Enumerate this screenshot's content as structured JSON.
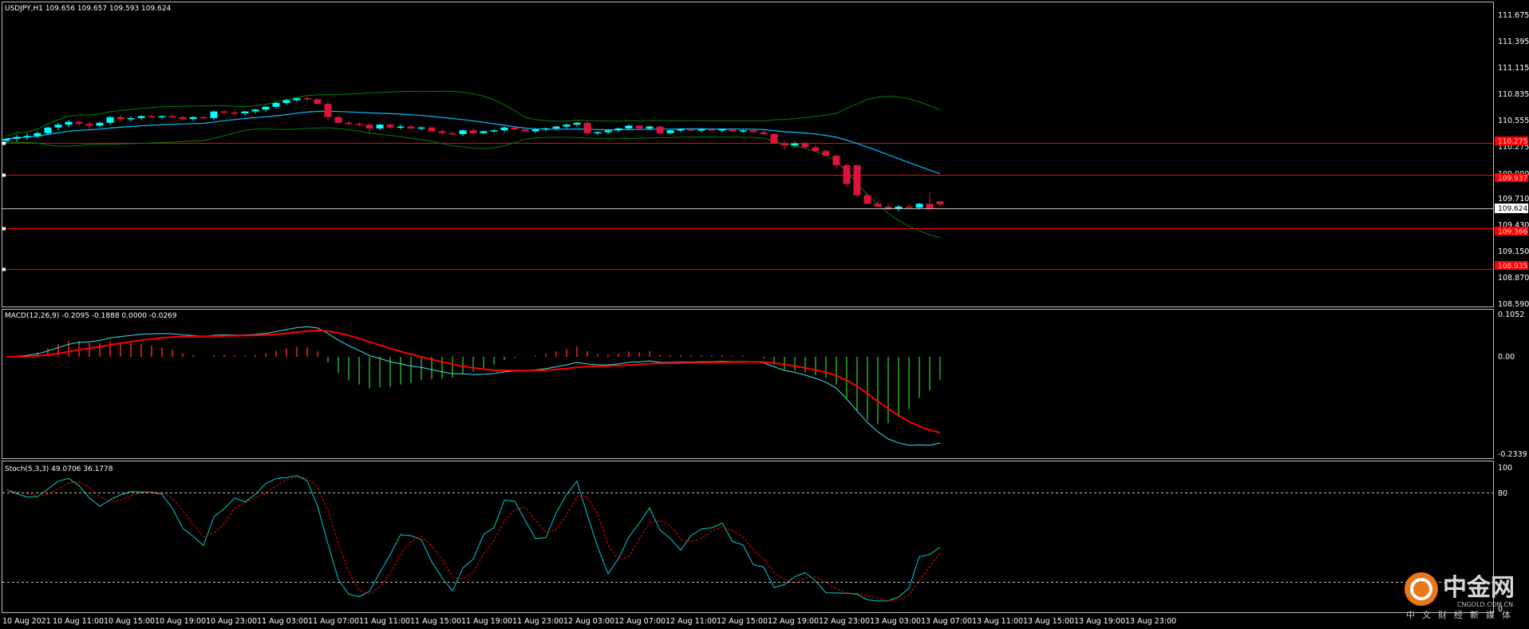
{
  "header": {
    "title": "USDJPY,H1  109.656 109.657 109.593 109.624",
    "macd_label": "MACD(12,26,9) -0.2095 -0.1888 0.0000 -0.0269",
    "stoch_label": "Stoch(5,3,3) 49.0706 36.1778"
  },
  "colors": {
    "background": "#000000",
    "bull_candle": "#00ffff",
    "bear_candle": "#dc143c",
    "band_outer": "#008000",
    "band_mid": "#00bfff",
    "level_line": "#ff0000",
    "macd_signal": "#ff0000",
    "stoch_main": "#00ced1",
    "stoch_signal": "#ff0000"
  },
  "price_axis": {
    "labels": [
      "111.675",
      "111.395",
      "111.115",
      "110.835",
      "110.555",
      "110.275",
      "109.990",
      "109.710",
      "109.430",
      "109.150",
      "108.870",
      "108.590"
    ],
    "current_price": "109.624",
    "level_tags": [
      "110.275",
      "109.937",
      "109.366",
      "108.935"
    ]
  },
  "macd_axis": {
    "labels": [
      "0.1052",
      "0.00",
      "-0.2339"
    ]
  },
  "stoch_axis": {
    "labels": [
      "100",
      "80",
      "0"
    ]
  },
  "time_axis": {
    "labels": [
      "10 Aug 2021",
      "10 Aug 11:00",
      "10 Aug 15:00",
      "10 Aug 19:00",
      "10 Aug 23:00",
      "11 Aug 03:00",
      "11 Aug 07:00",
      "11 Aug 11:00",
      "11 Aug 15:00",
      "11 Aug 19:00",
      "11 Aug 23:00",
      "12 Aug 03:00",
      "12 Aug 07:00",
      "12 Aug 11:00",
      "12 Aug 15:00",
      "12 Aug 19:00",
      "12 Aug 23:00",
      "13 Aug 03:00",
      "13 Aug 07:00",
      "13 Aug 11:00",
      "13 Aug 15:00",
      "13 Aug 19:00",
      "13 Aug 23:00"
    ]
  },
  "watermark": {
    "brand": "中金网",
    "domain": "CNGOLD.COM.CN",
    "sub": "中文财经新媒体"
  },
  "chart_data": {
    "type": "candlestick",
    "symbol": "USDJPY",
    "timeframe": "H1",
    "ylim": [
      108.59,
      111.675
    ],
    "horizontal_levels": [
      110.275,
      109.937,
      109.366,
      108.935
    ],
    "candles_ohlc": [
      [
        110.3,
        110.33,
        110.27,
        110.32
      ],
      [
        110.32,
        110.36,
        110.29,
        110.34
      ],
      [
        110.34,
        110.38,
        110.31,
        110.35
      ],
      [
        110.35,
        110.4,
        110.33,
        110.38
      ],
      [
        110.38,
        110.45,
        110.36,
        110.44
      ],
      [
        110.44,
        110.49,
        110.41,
        110.47
      ],
      [
        110.47,
        110.52,
        110.44,
        110.5
      ],
      [
        110.5,
        110.52,
        110.46,
        110.48
      ],
      [
        110.48,
        110.5,
        110.42,
        110.46
      ],
      [
        110.46,
        110.5,
        110.44,
        110.49
      ],
      [
        110.49,
        110.56,
        110.47,
        110.55
      ],
      [
        110.55,
        110.57,
        110.51,
        110.53
      ],
      [
        110.53,
        110.56,
        110.5,
        110.54
      ],
      [
        110.54,
        110.57,
        110.52,
        110.56
      ],
      [
        110.56,
        110.58,
        110.54,
        110.55
      ],
      [
        110.55,
        110.57,
        110.53,
        110.56
      ],
      [
        110.56,
        110.58,
        110.54,
        110.55
      ],
      [
        110.55,
        110.56,
        110.51,
        110.53
      ],
      [
        110.53,
        110.56,
        110.51,
        110.55
      ],
      [
        110.55,
        110.56,
        110.52,
        110.54
      ],
      [
        110.54,
        110.62,
        110.52,
        110.61
      ],
      [
        110.61,
        110.63,
        110.58,
        110.6
      ],
      [
        110.6,
        110.62,
        110.57,
        110.59
      ],
      [
        110.59,
        110.62,
        110.57,
        110.61
      ],
      [
        110.61,
        110.64,
        110.59,
        110.63
      ],
      [
        110.63,
        110.67,
        110.61,
        110.66
      ],
      [
        110.66,
        110.71,
        110.64,
        110.7
      ],
      [
        110.7,
        110.74,
        110.68,
        110.73
      ],
      [
        110.73,
        110.76,
        110.71,
        110.75
      ],
      [
        110.75,
        110.77,
        110.72,
        110.74
      ],
      [
        110.74,
        110.75,
        110.68,
        110.69
      ],
      [
        110.69,
        110.71,
        110.52,
        110.55
      ],
      [
        110.55,
        110.57,
        110.48,
        110.49
      ],
      [
        110.49,
        110.51,
        110.46,
        110.48
      ],
      [
        110.48,
        110.5,
        110.45,
        110.47
      ],
      [
        110.47,
        110.49,
        110.38,
        110.43
      ],
      [
        110.43,
        110.48,
        110.41,
        110.47
      ],
      [
        110.47,
        110.49,
        110.42,
        110.44
      ],
      [
        110.44,
        110.47,
        110.42,
        110.45
      ],
      [
        110.45,
        110.47,
        110.42,
        110.43
      ],
      [
        110.43,
        110.45,
        110.41,
        110.44
      ],
      [
        110.44,
        110.45,
        110.39,
        110.4
      ],
      [
        110.4,
        110.42,
        110.37,
        110.38
      ],
      [
        110.38,
        110.4,
        110.36,
        110.37
      ],
      [
        110.37,
        110.42,
        110.35,
        110.41
      ],
      [
        110.41,
        110.43,
        110.36,
        110.38
      ],
      [
        110.38,
        110.41,
        110.37,
        110.4
      ],
      [
        110.4,
        110.42,
        110.38,
        110.41
      ],
      [
        110.41,
        110.45,
        110.39,
        110.44
      ],
      [
        110.44,
        110.46,
        110.41,
        110.42
      ],
      [
        110.42,
        110.44,
        110.39,
        110.4
      ],
      [
        110.4,
        110.43,
        110.38,
        110.42
      ],
      [
        110.42,
        110.44,
        110.4,
        110.43
      ],
      [
        110.43,
        110.46,
        110.41,
        110.45
      ],
      [
        110.45,
        110.48,
        110.43,
        110.47
      ],
      [
        110.47,
        110.5,
        110.45,
        110.49
      ],
      [
        110.49,
        110.51,
        110.36,
        110.38
      ],
      [
        110.38,
        110.4,
        110.36,
        110.39
      ],
      [
        110.39,
        110.42,
        110.37,
        110.41
      ],
      [
        110.41,
        110.44,
        110.39,
        110.43
      ],
      [
        110.43,
        110.47,
        110.41,
        110.46
      ],
      [
        110.46,
        110.47,
        110.42,
        110.43
      ],
      [
        110.43,
        110.46,
        110.41,
        110.45
      ],
      [
        110.45,
        110.46,
        110.36,
        110.38
      ],
      [
        110.38,
        110.42,
        110.37,
        110.41
      ],
      [
        110.41,
        110.43,
        110.39,
        110.42
      ],
      [
        110.42,
        110.44,
        110.4,
        110.41
      ],
      [
        110.41,
        110.43,
        110.39,
        110.42
      ],
      [
        110.42,
        110.44,
        110.4,
        110.41
      ],
      [
        110.41,
        110.43,
        110.39,
        110.42
      ],
      [
        110.42,
        110.43,
        110.39,
        110.4
      ],
      [
        110.4,
        110.42,
        110.38,
        110.41
      ],
      [
        110.41,
        110.42,
        110.38,
        110.39
      ],
      [
        110.39,
        110.41,
        110.36,
        110.37
      ],
      [
        110.37,
        110.38,
        110.26,
        110.27
      ],
      [
        110.27,
        110.3,
        110.2,
        110.25
      ],
      [
        110.25,
        110.29,
        110.23,
        110.27
      ],
      [
        110.27,
        110.28,
        110.22,
        110.23
      ],
      [
        110.23,
        110.25,
        110.18,
        110.19
      ],
      [
        110.19,
        110.21,
        110.13,
        110.14
      ],
      [
        110.14,
        110.16,
        110.0,
        110.04
      ],
      [
        110.04,
        110.06,
        109.82,
        109.84
      ],
      [
        110.04,
        110.05,
        109.7,
        109.72
      ],
      [
        109.72,
        109.74,
        109.62,
        109.63
      ],
      [
        109.63,
        109.66,
        109.59,
        109.6
      ],
      [
        109.6,
        109.63,
        109.56,
        109.58
      ],
      [
        109.58,
        109.62,
        109.55,
        109.6
      ],
      [
        109.6,
        109.63,
        109.57,
        109.59
      ],
      [
        109.59,
        109.64,
        109.57,
        109.63
      ],
      [
        109.63,
        109.75,
        109.55,
        109.58
      ],
      [
        109.656,
        109.657,
        109.593,
        109.624
      ]
    ]
  }
}
